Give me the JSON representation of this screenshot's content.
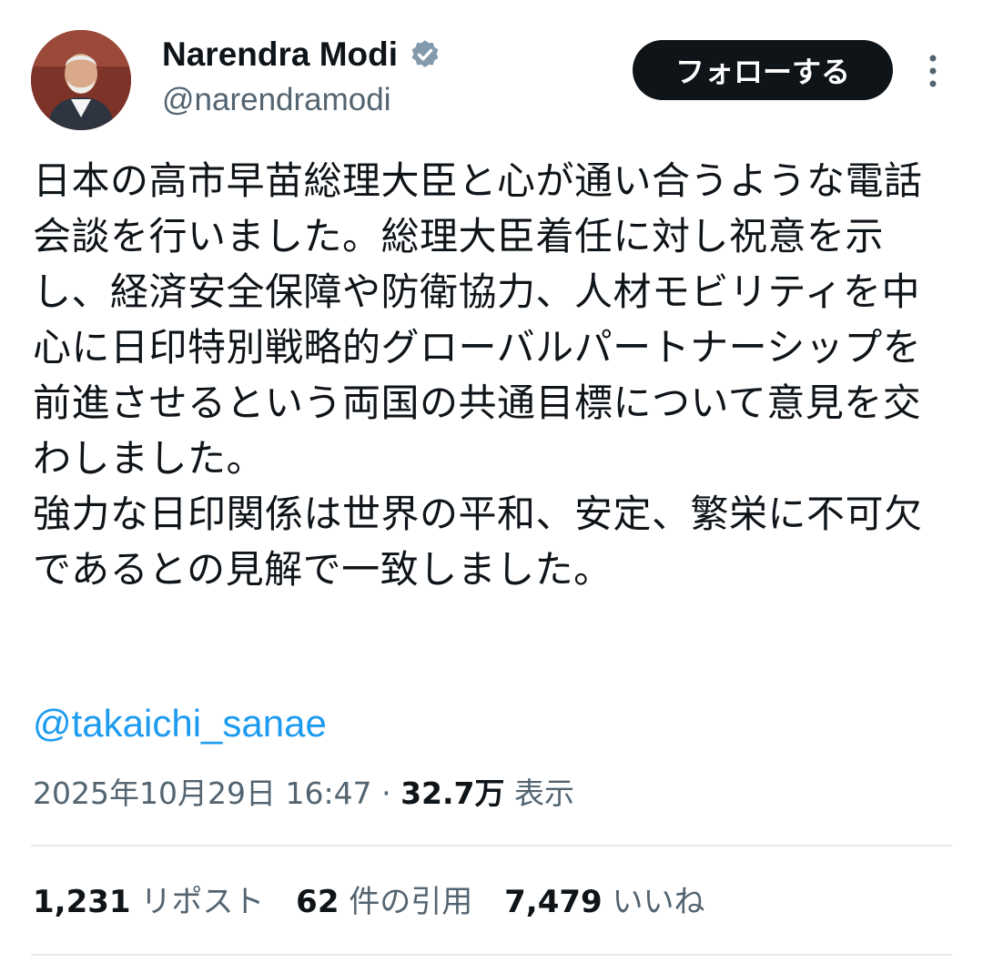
{
  "author": {
    "name": "Narendra Modi",
    "handle": "@narendramodi",
    "verified": true
  },
  "follow_button": {
    "label": "フォローする"
  },
  "tweet": {
    "text": "日本の高市早苗総理大臣と心が通い合うような電話会談を行いました。総理大臣着任に対し祝意を示し、経済安全保障や防衛協力、人材モビリティを中心に日印特別戦略的グローバルパートナーシップを前進させるという両国の共通目標について意見を交わしました。\n強力な日印関係は世界の平和、安定、繁栄に不可欠であるとの見解で一致しました。",
    "mention": "@takaichi_sanae"
  },
  "meta": {
    "timestamp": "2025年10月29日 16:47",
    "separator": "·",
    "views_count": "32.7万",
    "views_label": "表示"
  },
  "stats": {
    "reposts_count": "1,231",
    "reposts_label": "リポスト",
    "quotes_count": "62",
    "quotes_label": "件の引用",
    "likes_count": "7,479",
    "likes_label": "いいね"
  },
  "icons": {
    "verified": "verified-badge-icon",
    "more": "more-vertical-icon"
  },
  "colors": {
    "link": "#1d9bf0",
    "secondary_text": "#536471",
    "primary_text": "#0f1419",
    "verified_badge": "#829aab",
    "follow_button_bg": "#0f1419"
  }
}
